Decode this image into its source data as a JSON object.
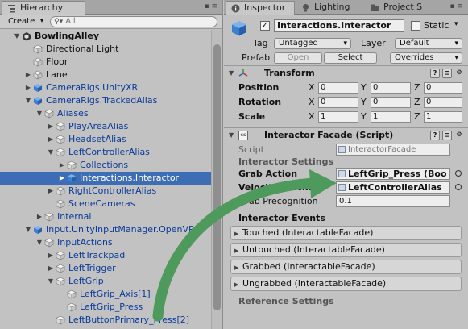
{
  "colors": {
    "selection": "#3d6eb5",
    "arrow": "#4e9a5d",
    "cube": "#e6e6e6",
    "prefab_blue": "#3c7fd0"
  },
  "hierarchy": {
    "tab_label": "Hierarchy",
    "create_label": "Create",
    "search_placeholder": "All",
    "rows": [
      {
        "label": "BowlingAlley",
        "depth": 0,
        "arrow": "down",
        "icon": "unity-scene-icon",
        "kind": "scene"
      },
      {
        "label": "Directional Light",
        "depth": 1,
        "arrow": "",
        "icon": "cube-icon",
        "kind": "normal"
      },
      {
        "label": "Floor",
        "depth": 1,
        "arrow": "",
        "icon": "cube-icon",
        "kind": "normal"
      },
      {
        "label": "Lane",
        "depth": 1,
        "arrow": "right",
        "icon": "cube-icon",
        "kind": "normal"
      },
      {
        "label": "CameraRigs.UnityXR",
        "depth": 1,
        "arrow": "right",
        "icon": "prefab-cube-icon",
        "kind": "blue"
      },
      {
        "label": "CameraRigs.TrackedAlias",
        "depth": 1,
        "arrow": "down",
        "icon": "prefab-cube-icon",
        "kind": "blue"
      },
      {
        "label": "Aliases",
        "depth": 2,
        "arrow": "down",
        "icon": "cube-icon",
        "kind": "blue"
      },
      {
        "label": "PlayAreaAlias",
        "depth": 3,
        "arrow": "right",
        "icon": "cube-icon",
        "kind": "blue"
      },
      {
        "label": "HeadsetAlias",
        "depth": 3,
        "arrow": "right",
        "icon": "cube-icon",
        "kind": "blue"
      },
      {
        "label": "LeftControllerAlias",
        "depth": 3,
        "arrow": "down",
        "icon": "cube-icon",
        "kind": "blue"
      },
      {
        "label": "Collections",
        "depth": 4,
        "arrow": "right",
        "icon": "cube-icon",
        "kind": "blue"
      },
      {
        "label": "Interactions.Interactor",
        "depth": 4,
        "arrow": "right",
        "icon": "prefab-cube-icon",
        "kind": "selected"
      },
      {
        "label": "RightControllerAlias",
        "depth": 3,
        "arrow": "right",
        "icon": "cube-icon",
        "kind": "blue"
      },
      {
        "label": "SceneCameras",
        "depth": 3,
        "arrow": "",
        "icon": "cube-icon",
        "kind": "blue"
      },
      {
        "label": "Internal",
        "depth": 2,
        "arrow": "right",
        "icon": "cube-icon",
        "kind": "blue"
      },
      {
        "label": "Input.UnityInputManager.OpenVR.L",
        "depth": 1,
        "arrow": "down",
        "icon": "prefab-cube-icon",
        "kind": "blue"
      },
      {
        "label": "InputActions",
        "depth": 2,
        "arrow": "down",
        "icon": "cube-icon",
        "kind": "blue"
      },
      {
        "label": "LeftTrackpad",
        "depth": 3,
        "arrow": "right",
        "icon": "cube-icon",
        "kind": "blue"
      },
      {
        "label": "LeftTrigger",
        "depth": 3,
        "arrow": "right",
        "icon": "cube-icon",
        "kind": "blue"
      },
      {
        "label": "LeftGrip",
        "depth": 3,
        "arrow": "down",
        "icon": "cube-icon",
        "kind": "blue"
      },
      {
        "label": "LeftGrip_Axis[1]",
        "depth": 4,
        "arrow": "",
        "icon": "cube-icon",
        "kind": "blue"
      },
      {
        "label": "LeftGrip_Press",
        "depth": 4,
        "arrow": "",
        "icon": "cube-icon",
        "kind": "blue"
      },
      {
        "label": "LeftButtonPrimary_Press[2]",
        "depth": 3,
        "arrow": "",
        "icon": "cube-icon",
        "kind": "blue"
      }
    ]
  },
  "inspector": {
    "tabs": [
      {
        "label": "Inspector",
        "icon": "info-icon"
      },
      {
        "label": "Lighting",
        "icon": "lightbulb-icon"
      },
      {
        "label": "Project S",
        "icon": "folder-icon"
      }
    ],
    "object_name": "Interactions.Interactor",
    "static_label": "Static",
    "tag_label": "Tag",
    "tag_value": "Untagged",
    "layer_label": "Layer",
    "layer_value": "Default",
    "prefab_label": "Prefab",
    "open_label": "Open",
    "select_label": "Select",
    "overrides_label": "Overrides",
    "transform": {
      "title": "Transform",
      "rows": [
        {
          "label": "Position",
          "x": "0",
          "y": "0",
          "z": "0"
        },
        {
          "label": "Rotation",
          "x": "0",
          "y": "0",
          "z": "0"
        },
        {
          "label": "Scale",
          "x": "1",
          "y": "1",
          "z": "1"
        }
      ],
      "axis_x": "X",
      "axis_y": "Y",
      "axis_z": "Z"
    },
    "facade": {
      "title": "Interactor Facade (Script)",
      "script_label": "Script",
      "script_value": "InteractorFacade",
      "section_label": "Interactor Settings",
      "grab_action_label": "Grab Action",
      "grab_action_value": "LeftGrip_Press (Boo",
      "velocity_tracker_label": "Velocity Tracker",
      "velocity_tracker_value": "LeftControllerAlias",
      "grab_precognition_label": "Grab Precognition",
      "grab_precognition_value": "0.1",
      "events_label": "Interactor Events",
      "events": [
        "Touched (InteractableFacade)",
        "Untouched (InteractableFacade)",
        "Grabbed (InteractableFacade)",
        "Ungrabbed (InteractableFacade)"
      ],
      "reference_label": "Reference Settings"
    }
  }
}
